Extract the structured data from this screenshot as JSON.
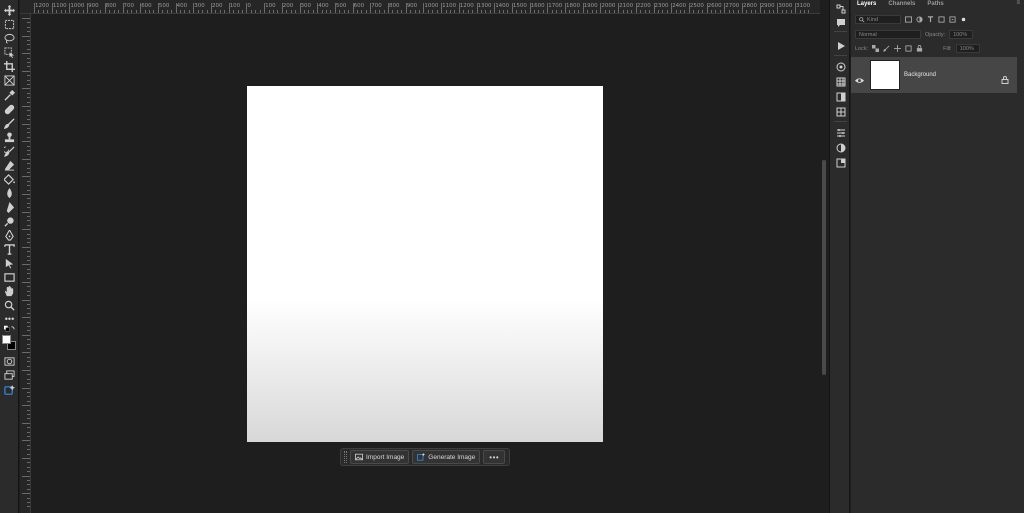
{
  "ruler": {
    "ticks": [
      "1200",
      "1100",
      "1000",
      "900",
      "800",
      "700",
      "600",
      "500",
      "400",
      "300",
      "200",
      "100",
      "0",
      "100",
      "200",
      "300",
      "400",
      "500",
      "600",
      "700",
      "800",
      "900",
      "1000",
      "1100",
      "1200",
      "1300",
      "1400",
      "1500",
      "1600",
      "1700",
      "1800",
      "1900",
      "2000",
      "2100",
      "2200",
      "2300",
      "2400",
      "2500",
      "2600",
      "2700",
      "2800",
      "2900",
      "3000",
      "3100"
    ]
  },
  "toolbar": {
    "tools": [
      "move-tool",
      "marquee-tool",
      "lasso-tool",
      "object-select-tool",
      "crop-tool",
      "frame-tool",
      "eyedropper-tool",
      "healing-brush-tool",
      "brush-tool",
      "clone-stamp-tool",
      "history-brush-tool",
      "eraser-tool",
      "paint-bucket-tool",
      "blur-tool",
      "dodge-tool",
      "pen-tool",
      "type-tool",
      "path-select-tool",
      "rectangle-tool",
      "hand-tool",
      "zoom-tool",
      "more-tools"
    ],
    "foreground_color": "#ffffff",
    "background_color": "#000000"
  },
  "taskbar": {
    "import_label": "Import Image",
    "generate_label": "Generate Image",
    "more_label": "•••"
  },
  "panel": {
    "tabs": [
      "Layers",
      "Channels",
      "Paths"
    ],
    "filter_placeholder": "Kind",
    "blend_mode": "Normal",
    "opacity_label": "Opacity:",
    "opacity_value": "100%",
    "lock_label": "Lock:",
    "fill_label": "Fill:",
    "fill_value": "100%",
    "layers": [
      {
        "name": "Background",
        "visible": true,
        "locked": true
      }
    ]
  },
  "colors": {
    "accent": "#2d8ceb",
    "panel_bg": "#2b2b2b",
    "workspace_bg": "#1e1e1e",
    "selected_layer": "#464646"
  }
}
